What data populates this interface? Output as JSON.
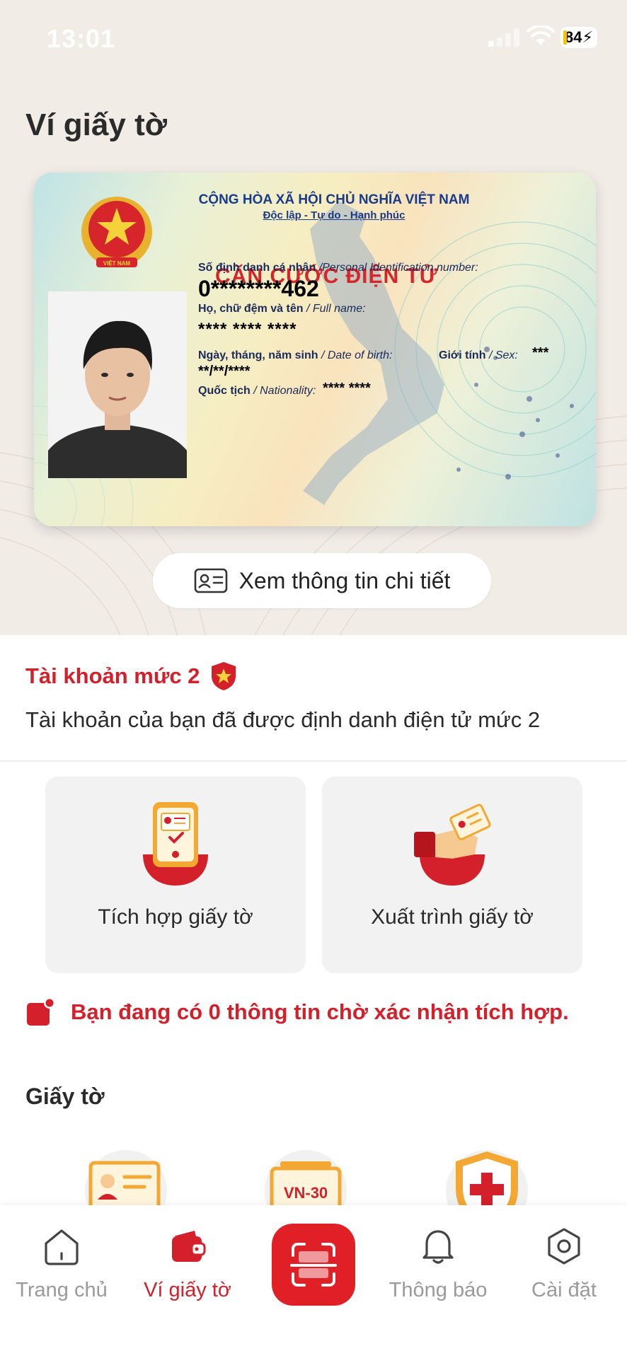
{
  "status_bar": {
    "time": "13:01",
    "battery": "84"
  },
  "page": {
    "title": "Ví giấy tờ"
  },
  "id_card": {
    "country": "CỘNG HÒA XÃ HỘI CHỦ NGHĨA VIỆT NAM",
    "motto": "Độc lập - Tự do - Hạnh phúc",
    "card_type": "CĂN CƯỚC ĐIỆN TỬ",
    "emblem_text": "VIỆT NAM",
    "id_label": "Số định danh cá nhân",
    "id_label_en": "/Personal Identification number:",
    "id_value": "0********462",
    "name_label": "Họ, chữ đệm và tên",
    "name_label_en": "/ Full name:",
    "name_value": "**** **** ****",
    "dob_label": "Ngày, tháng, năm sinh",
    "dob_label_en": "/ Date of birth:",
    "dob_value": "**/**/****",
    "sex_label": "Giới tính",
    "sex_label_en": "/ Sex:",
    "sex_value": "***",
    "nationality_label": "Quốc tịch",
    "nationality_label_en": "/ Nationality:",
    "nationality_value": "**** ****"
  },
  "detail_button": {
    "label": "Xem thông tin chi tiết",
    "icon": "id-card-icon"
  },
  "account": {
    "level_title": "Tài khoản mức 2",
    "level_icon": "shield-star-icon",
    "description": "Tài khoản của bạn đã được định danh điện tử mức 2"
  },
  "actions": [
    {
      "label": "Tích hợp giấy tờ",
      "icon": "phone-document-icon"
    },
    {
      "label": "Xuất trình giấy tờ",
      "icon": "hand-card-icon"
    }
  ],
  "pending": {
    "text": "Bạn đang có 0 thông tin chờ xác nhận tích hợp.",
    "icon": "notification-dot-icon"
  },
  "documents": {
    "title": "Giấy tờ",
    "items": [
      {
        "icon": "license-card-icon"
      },
      {
        "icon": "vehicle-plate-icon",
        "text": "VN-30"
      },
      {
        "icon": "health-shield-icon"
      }
    ]
  },
  "nav": {
    "items": [
      {
        "label": "Trang chủ",
        "icon": "home-icon",
        "active": false
      },
      {
        "label": "Ví giấy tờ",
        "icon": "wallet-icon",
        "active": true
      },
      {
        "label": "",
        "icon": "scan-qr-icon",
        "active": false
      },
      {
        "label": "Thông báo",
        "icon": "bell-icon",
        "active": false
      },
      {
        "label": "Cài đặt",
        "icon": "settings-icon",
        "active": false
      }
    ]
  },
  "colors": {
    "accent": "#d3202a",
    "top_background": "#f1ece6",
    "tile_background": "#f2f2f2"
  }
}
